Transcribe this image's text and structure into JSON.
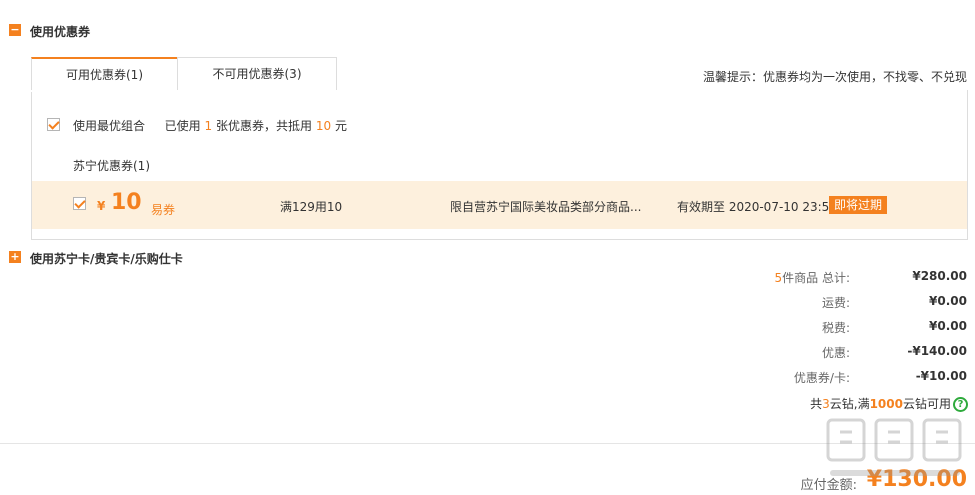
{
  "coupon_section": {
    "toggle_icon": "minus-icon",
    "title": "使用优惠券",
    "tabs": [
      {
        "label": "可用优惠券(1)",
        "active": true
      },
      {
        "label": "不可用优惠券(3)",
        "active": false
      }
    ],
    "tip": "温馨提示：优惠券均为一次使用，不找零、不兑现",
    "best_combo": {
      "checked": true,
      "label": "使用最优组合",
      "used_prefix": "已使用",
      "used_count": "1",
      "used_mid": "张优惠券，共抵用",
      "used_amount": "10",
      "used_suffix": "元"
    },
    "group_title": "苏宁优惠券(1)",
    "coupons": [
      {
        "checked": true,
        "currency": "¥",
        "amount": "10",
        "type": "易券",
        "condition": "满129用10",
        "scope": "限自营苏宁国际美妆品类部分商品...",
        "validity": "有效期至 2020-07-10 23:59",
        "badge": "即将过期"
      }
    ]
  },
  "card_section": {
    "toggle_icon": "plus-icon",
    "title": "使用苏宁卡/贵宾卡/乐购仕卡"
  },
  "summary": {
    "item_count": "5",
    "item_count_suffix": "件商品 总计:",
    "total": "¥280.00",
    "shipping_label": "运费:",
    "shipping": "¥0.00",
    "tax_label": "税费:",
    "tax": "¥0.00",
    "discount_label": "优惠:",
    "discount": "-¥140.00",
    "coupon_label": "优惠券/卡:",
    "coupon": "-¥10.00",
    "cloud_prefix": "共",
    "cloud_count": "3",
    "cloud_mid": "云钻,满",
    "cloud_threshold": "1000",
    "cloud_suffix": "云钻可用",
    "help_icon": "question-circle-icon",
    "payable_label": "应付金额:",
    "payable": "¥130.00"
  },
  "watermark": {
    "text": "值 什么值得买"
  },
  "colors": {
    "accent": "#f4811f",
    "row_highlight": "#fdf0dd",
    "help_green": "#2eaa3c",
    "border": "#dddddd"
  }
}
